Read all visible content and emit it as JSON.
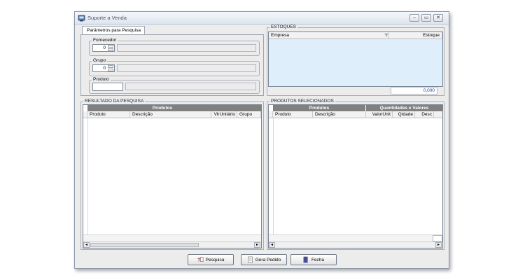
{
  "window": {
    "title": "Suporte a Venda",
    "controls": [
      "–",
      "▭",
      "✕"
    ]
  },
  "tabs": [
    "Parâmetros para Pesquisa"
  ],
  "params": {
    "fornecedor": {
      "label": "Fornecedor",
      "value": "0"
    },
    "grupo": {
      "label": "Grupo",
      "value": "0"
    },
    "produto": {
      "label": "Produto",
      "value": ""
    }
  },
  "estoques": {
    "label": "ESTOQUES",
    "columns": [
      "Empresa",
      "Estoque"
    ],
    "total": "0,000"
  },
  "resultado": {
    "label": "RESULTADO DA PESQUISA",
    "banner": "Produtos",
    "columns": [
      "Produto",
      "Descrição",
      "VlrUnitário",
      "Grupo"
    ]
  },
  "selecionados": {
    "label": "PRODUTOS SELECIONADOS",
    "banner_left": "Produtos",
    "banner_right": "Quantidades e Valores",
    "columns": [
      "Produto",
      "Descrição",
      "ValorUnit",
      "Qtdade",
      "Desc"
    ]
  },
  "buttons": {
    "pesquisa": "Pesquisa",
    "gera_pedido": "Gera Pedido",
    "fecha": "Fecha"
  }
}
